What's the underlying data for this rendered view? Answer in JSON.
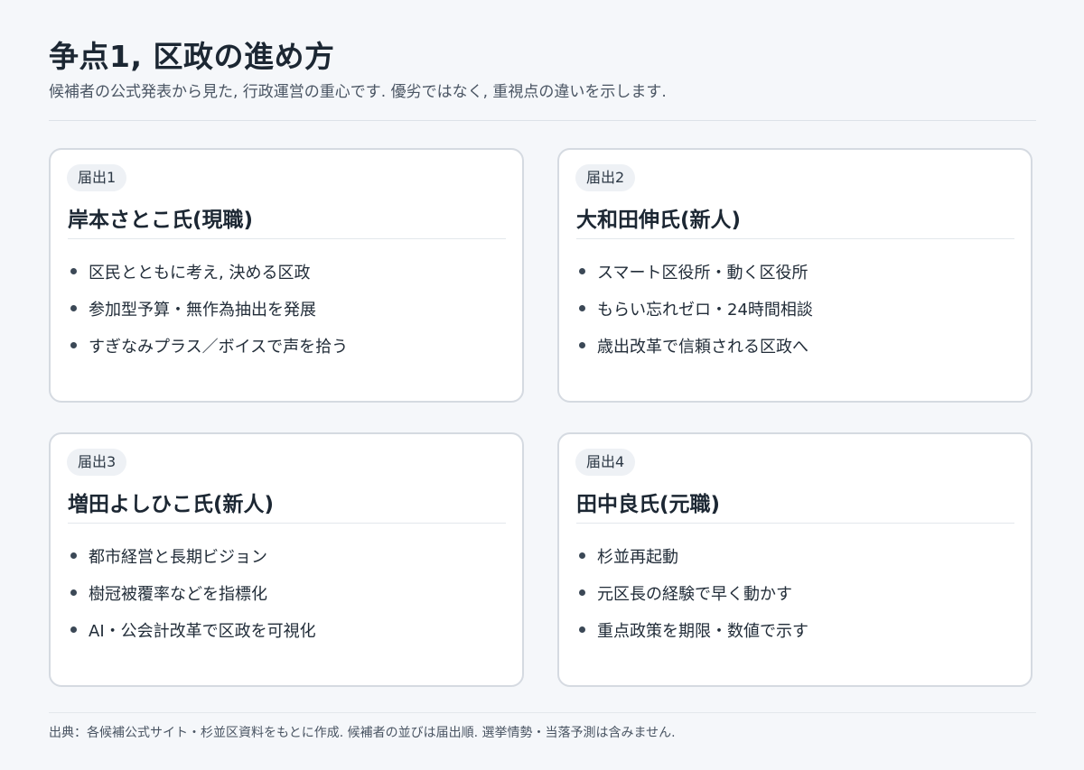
{
  "header": {
    "title": "争点1, 区政の進め方",
    "subtitle": "候補者の公式発表から見た, 行政運営の重心です. 優劣ではなく, 重視点の違いを示します."
  },
  "cards": [
    {
      "badge": "届出1",
      "name": "岸本さとこ氏(現職)",
      "points": [
        "区民とともに考え, 決める区政",
        "参加型予算・無作為抽出を発展",
        "すぎなみプラス／ボイスで声を拾う"
      ]
    },
    {
      "badge": "届出2",
      "name": "大和田伸氏(新人)",
      "points": [
        "スマート区役所・動く区役所",
        "もらい忘れゼロ・24時間相談",
        "歳出改革で信頼される区政へ"
      ]
    },
    {
      "badge": "届出3",
      "name": "増田よしひこ氏(新人)",
      "points": [
        "都市経営と長期ビジョン",
        "樹冠被覆率などを指標化",
        "AI・公会計改革で区政を可視化"
      ]
    },
    {
      "badge": "届出4",
      "name": "田中良氏(元職)",
      "points": [
        "杉並再起動",
        "元区長の経験で早く動かす",
        "重点政策を期限・数値で示す"
      ]
    }
  ],
  "footer": {
    "note": "出典：各候補公式サイト・杉並区資料をもとに作成. 候補者の並びは届出順. 選挙情勢・当落予測は含みません."
  }
}
